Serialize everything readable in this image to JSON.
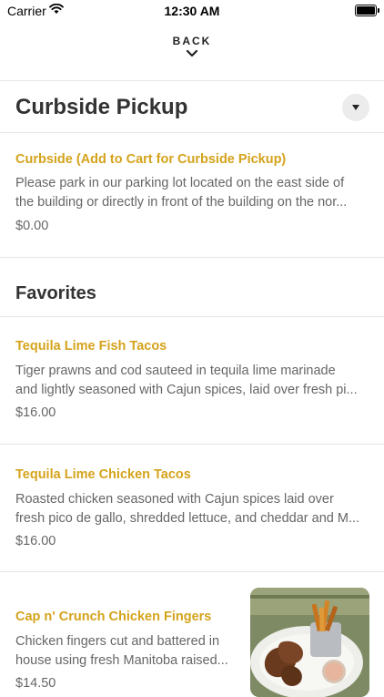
{
  "status_bar": {
    "carrier": "Carrier",
    "time": "12:30 AM"
  },
  "nav": {
    "back_label": "BACK"
  },
  "colors": {
    "accent": "#d4a31c",
    "text": "#333333",
    "muted": "#666666",
    "divider": "#e6e6e6"
  },
  "sections": [
    {
      "title": "Curbside Pickup",
      "items": [
        {
          "name": "Curbside (Add to Cart for Curbside Pickup)",
          "desc_lines": [
            "Please park in our parking lot located on the east side of",
            "the building or directly in front of the building on the nor..."
          ],
          "price": "$0.00"
        }
      ]
    },
    {
      "title": "Favorites",
      "items": [
        {
          "name": "Tequila Lime Fish Tacos",
          "desc_lines": [
            "Tiger prawns and cod sauteed in tequila lime marinade",
            "and lightly seasoned with Cajun spices, laid over fresh pi..."
          ],
          "price": "$16.00"
        },
        {
          "name": "Tequila Lime Chicken Tacos",
          "desc_lines": [
            "Roasted chicken seasoned with Cajun spices laid over",
            "fresh pico de gallo, shredded lettuce, and cheddar and M..."
          ],
          "price": "$16.00"
        },
        {
          "name": "Cap n' Crunch Chicken Fingers",
          "desc_lines": [
            "Chicken fingers cut and battered in",
            "house using fresh Manitoba raised..."
          ],
          "price": "$14.50",
          "image": "chicken-fingers-photo"
        }
      ]
    }
  ]
}
